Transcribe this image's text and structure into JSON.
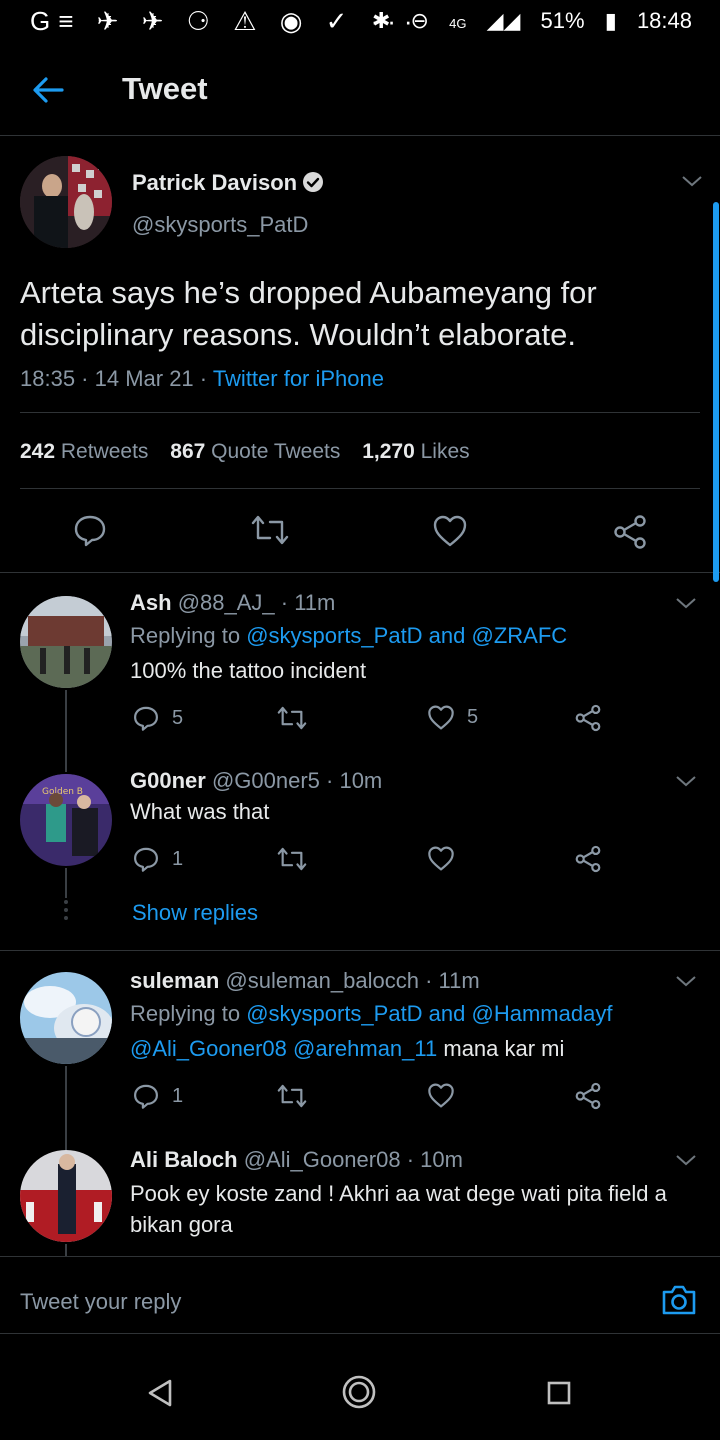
{
  "status_bar": {
    "left_icons": "G≡ ✈ ✈ ⚆ ⚠ ◉ ✓ ···",
    "network": "4G",
    "battery": "51%",
    "time": "18:48"
  },
  "header": {
    "title": "Tweet"
  },
  "main_tweet": {
    "author_name": "Patrick Davison",
    "author_handle": "@skysports_PatD",
    "text": "Arteta says he’s dropped Aubameyang for disciplinary reasons. Wouldn’t elaborate.",
    "timestamp": "18:35 · 14 Mar 21 · ",
    "source": "Twitter for iPhone",
    "stats": {
      "retweets_count": "242",
      "retweets_label": "Retweets",
      "quotes_count": "867",
      "quotes_label": "Quote Tweets",
      "likes_count": "1,270",
      "likes_label": "Likes"
    }
  },
  "replies": [
    {
      "name": "Ash",
      "handle": "@88_AJ_",
      "time": " · 11m",
      "replying_prefix": "Replying to ",
      "replying_to": "@skysports_PatD and @ZRAFC",
      "text": "100% the tattoo incident",
      "reply_count": "5",
      "like_count": "5"
    },
    {
      "name": "G00ner",
      "handle": "@G00ner5",
      "time": " · 10m",
      "text": "What was that",
      "reply_count": "1",
      "avatar_text": "Golden B",
      "show_replies": "Show replies"
    },
    {
      "name": "suleman",
      "handle": "@suleman_balocch",
      "time": " · 11m",
      "replying_prefix": "Replying to ",
      "replying_to": "@skysports_PatD and @Hammadayf",
      "mention1": "@Ali_Gooner08",
      "mention2": "@arehman_11",
      "text": " mana kar mi",
      "reply_count": "1"
    },
    {
      "name": "Ali Baloch",
      "handle": "@Ali_Gooner08",
      "time": " · 10m",
      "text_line1": "Pook ey koste zand ! Akhri aa wat dege wati pita field a",
      "text_line2": "bikan gora"
    }
  ],
  "composer": {
    "placeholder": "Tweet your reply"
  },
  "colors": {
    "accent": "#1d9bf0",
    "background": "#000000",
    "muted": "#8b98a5",
    "divider": "#2f3336"
  }
}
